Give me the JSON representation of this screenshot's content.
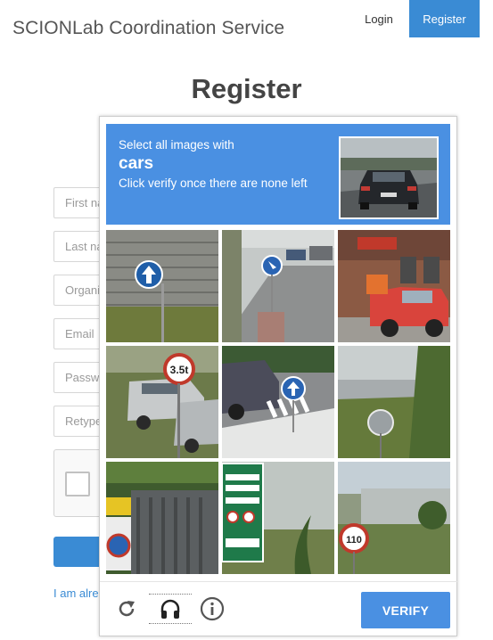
{
  "navbar": {
    "brand": "SCIONLab Coordination Service",
    "login_label": "Login",
    "register_label": "Register"
  },
  "page": {
    "title": "Register"
  },
  "form": {
    "first_name_placeholder": "First name",
    "last_name_placeholder": "Last name",
    "organisation_placeholder": "Organisation",
    "email_placeholder": "Email",
    "password_placeholder": "Password",
    "retype_placeholder": "Retype password",
    "login_link": "I am already registered"
  },
  "challenge": {
    "instruction_line1": "Select all images with",
    "keyword": "cars",
    "instruction_line2": "Click verify once there are none left",
    "tiles": [
      {
        "content": "building-with-arrow-sign"
      },
      {
        "content": "street-with-sign-and-cars"
      },
      {
        "content": "red-pickup-truck"
      },
      {
        "content": "parked-cars-and-sign"
      },
      {
        "content": "roundabout-with-sign"
      },
      {
        "content": "road-sign-field"
      },
      {
        "content": "fence-with-sign"
      },
      {
        "content": "highway-sign"
      },
      {
        "content": "speed-limit-sign"
      }
    ],
    "reload_icon": "reload-icon",
    "audio_icon": "headphones-icon",
    "info_icon": "info-icon",
    "verify_label": "VERIFY"
  },
  "colors": {
    "primary": "#3a8bd4",
    "captcha_blue": "#4a90e2"
  }
}
